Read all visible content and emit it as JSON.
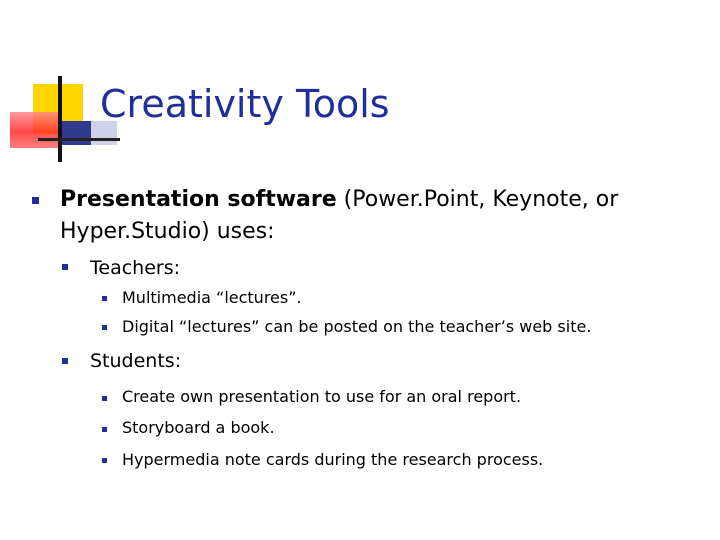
{
  "slide": {
    "title": "Creativity Tools",
    "main_bullet": {
      "bold": "Presentation software",
      "rest_line1": " (Power.Point, Keynote, or",
      "line2": "Hyper.Studio) uses:"
    },
    "groups": [
      {
        "label": "Teachers:",
        "items": [
          "Multimedia “lectures”.",
          "Digital “lectures” can be posted on the teacher’s web site."
        ]
      },
      {
        "label": "Students:",
        "items": [
          "Create own presentation to use for an oral report.",
          "Storyboard a book.",
          "Hypermedia note cards during the research process."
        ]
      }
    ],
    "colors": {
      "title": "#1f2f9a",
      "bullet": "#1f2f9a",
      "logo_yellow": "#ffd500",
      "logo_red": "#ff2a2a",
      "logo_blue": "#2f3b8f"
    }
  }
}
